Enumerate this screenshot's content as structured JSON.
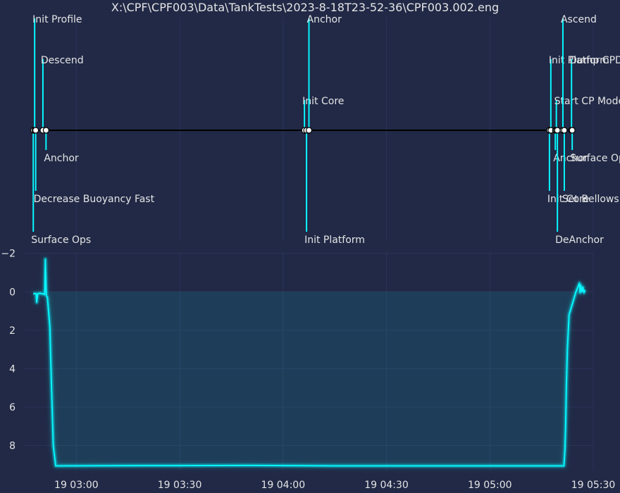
{
  "title": "X:\\CPF\\CPF003\\Data\\TankTests\\2023-8-18T23-52-36\\CPF003.002.eng",
  "colors": {
    "background": "#212946",
    "grid": "#2a3459",
    "text": "#e5e5e5",
    "accent": "#08F7FE",
    "timeline": "#000000"
  },
  "chart_data": [
    {
      "type": "timeline",
      "x_unit": "minutes since 19 02:00",
      "events": [
        {
          "label": "Surface Ops",
          "x": 47.5,
          "level": -3
        },
        {
          "label": "Init Profile",
          "x": 47.9,
          "level": 3
        },
        {
          "label": "Decrease Buoyancy Fast",
          "x": 48.2,
          "level": -2
        },
        {
          "label": "Descend",
          "x": 50.3,
          "level": 2
        },
        {
          "label": "Anchor",
          "x": 51.2,
          "level": -1
        },
        {
          "label": "Init Core",
          "x": 126.2,
          "level": 1
        },
        {
          "label": "Init Platform",
          "x": 126.8,
          "level": -3
        },
        {
          "label": "Anchor",
          "x": 127.5,
          "level": 3
        },
        {
          "label": "Init Core",
          "x": 197.3,
          "level": -2
        },
        {
          "label": "Init Platform",
          "x": 197.7,
          "level": 2
        },
        {
          "label": "Anchor",
          "x": 199.0,
          "level": -1
        },
        {
          "label": "Start CP Mode",
          "x": 199.3,
          "level": 1
        },
        {
          "label": "DeAnchor",
          "x": 199.6,
          "level": -3
        },
        {
          "label": "Ascend",
          "x": 201.2,
          "level": 3
        },
        {
          "label": "Set Bellows",
          "x": 201.6,
          "level": -2
        },
        {
          "label": "Dump CPData",
          "x": 203.7,
          "level": 2
        },
        {
          "label": "Surface Ops",
          "x": 203.9,
          "level": -1
        }
      ]
    },
    {
      "type": "area",
      "x_unit": "minutes since 19 02:00",
      "xlim": [
        45,
        210
      ],
      "ylim": [
        9.3,
        -2.1
      ],
      "y_inverted": true,
      "x_ticks": [
        {
          "value": 60,
          "label": "19 03:00"
        },
        {
          "value": 90,
          "label": "19 03:30"
        },
        {
          "value": 120,
          "label": "19 04:00"
        },
        {
          "value": 150,
          "label": "19 04:30"
        },
        {
          "value": 180,
          "label": "19 05:00"
        },
        {
          "value": 210,
          "label": "19 05:30"
        }
      ],
      "y_ticks": [
        {
          "value": -2,
          "label": "−2"
        },
        {
          "value": 0,
          "label": "0"
        },
        {
          "value": 2,
          "label": "2"
        },
        {
          "value": 4,
          "label": "4"
        },
        {
          "value": 6,
          "label": "6"
        },
        {
          "value": 8,
          "label": "8"
        }
      ],
      "grid": true,
      "series": [
        {
          "x": [
            47.5,
            48.0,
            48.3,
            48.5,
            48.8,
            49.5,
            50.4,
            50.6,
            50.8,
            51.0,
            51.3,
            51.6,
            52.3,
            52.8,
            53.3,
            54.0,
            80.0,
            110.0,
            135.0,
            160.0,
            185.0,
            199.0,
            201.5,
            201.6,
            201.8,
            202.0,
            202.2,
            202.5,
            203.0,
            203.5,
            204.0,
            204.5,
            205.0,
            206.0,
            206.2,
            206.4,
            206.7,
            207.0,
            207.3,
            207.6
          ],
          "y": [
            0.1,
            0.1,
            0.1,
            0.55,
            0.1,
            0.08,
            0.12,
            0.1,
            0.15,
            -1.7,
            0.2,
            0.3,
            1.8,
            5.0,
            8.0,
            9.06,
            9.05,
            9.04,
            9.06,
            9.06,
            9.06,
            9.06,
            9.06,
            8.8,
            8.2,
            7.0,
            5.0,
            3.0,
            1.2,
            0.9,
            0.6,
            0.3,
            0.0,
            -0.45,
            0.05,
            -0.35,
            0.0,
            -0.25,
            0.05,
            -0.1
          ]
        }
      ]
    }
  ]
}
